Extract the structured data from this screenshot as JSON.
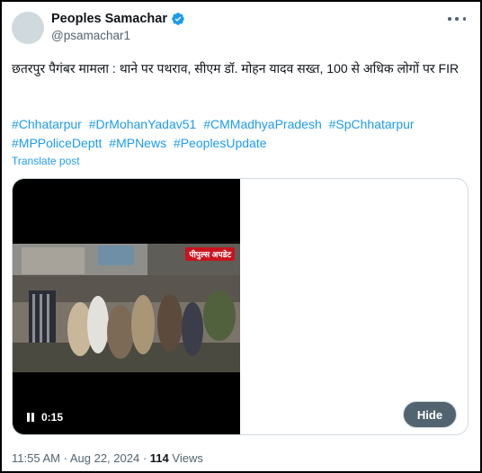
{
  "author": {
    "name": "Peoples Samachar",
    "handle": "@psamachar1",
    "verified": true
  },
  "post": {
    "text": "छतरपुर पैगंबर मामला : थाने पर पथराव, सीएम डॉ. मोहन यादव सख्त, 100 से अधिक लोगों पर FIR",
    "hashtags": [
      "#Chhatarpur",
      "#DrMohanYadav51",
      "#CMMadhyaPradesh",
      "#SpChhatarpur",
      "#MPPoliceDeptt",
      "#MPNews",
      "#PeoplesUpdate"
    ],
    "translate_label": "Translate post"
  },
  "media": {
    "channel_logo": "पीपुल्स अपडेट",
    "time": "0:15",
    "hide_label": "Hide"
  },
  "meta": {
    "time": "11:55 AM",
    "separator": "·",
    "date": "Aug 22, 2024",
    "views_count": "114",
    "views_label": "Views"
  },
  "colors": {
    "link": "#1d9bf0",
    "secondary_text": "#536471",
    "verified_badge": "#1d9bf0"
  }
}
